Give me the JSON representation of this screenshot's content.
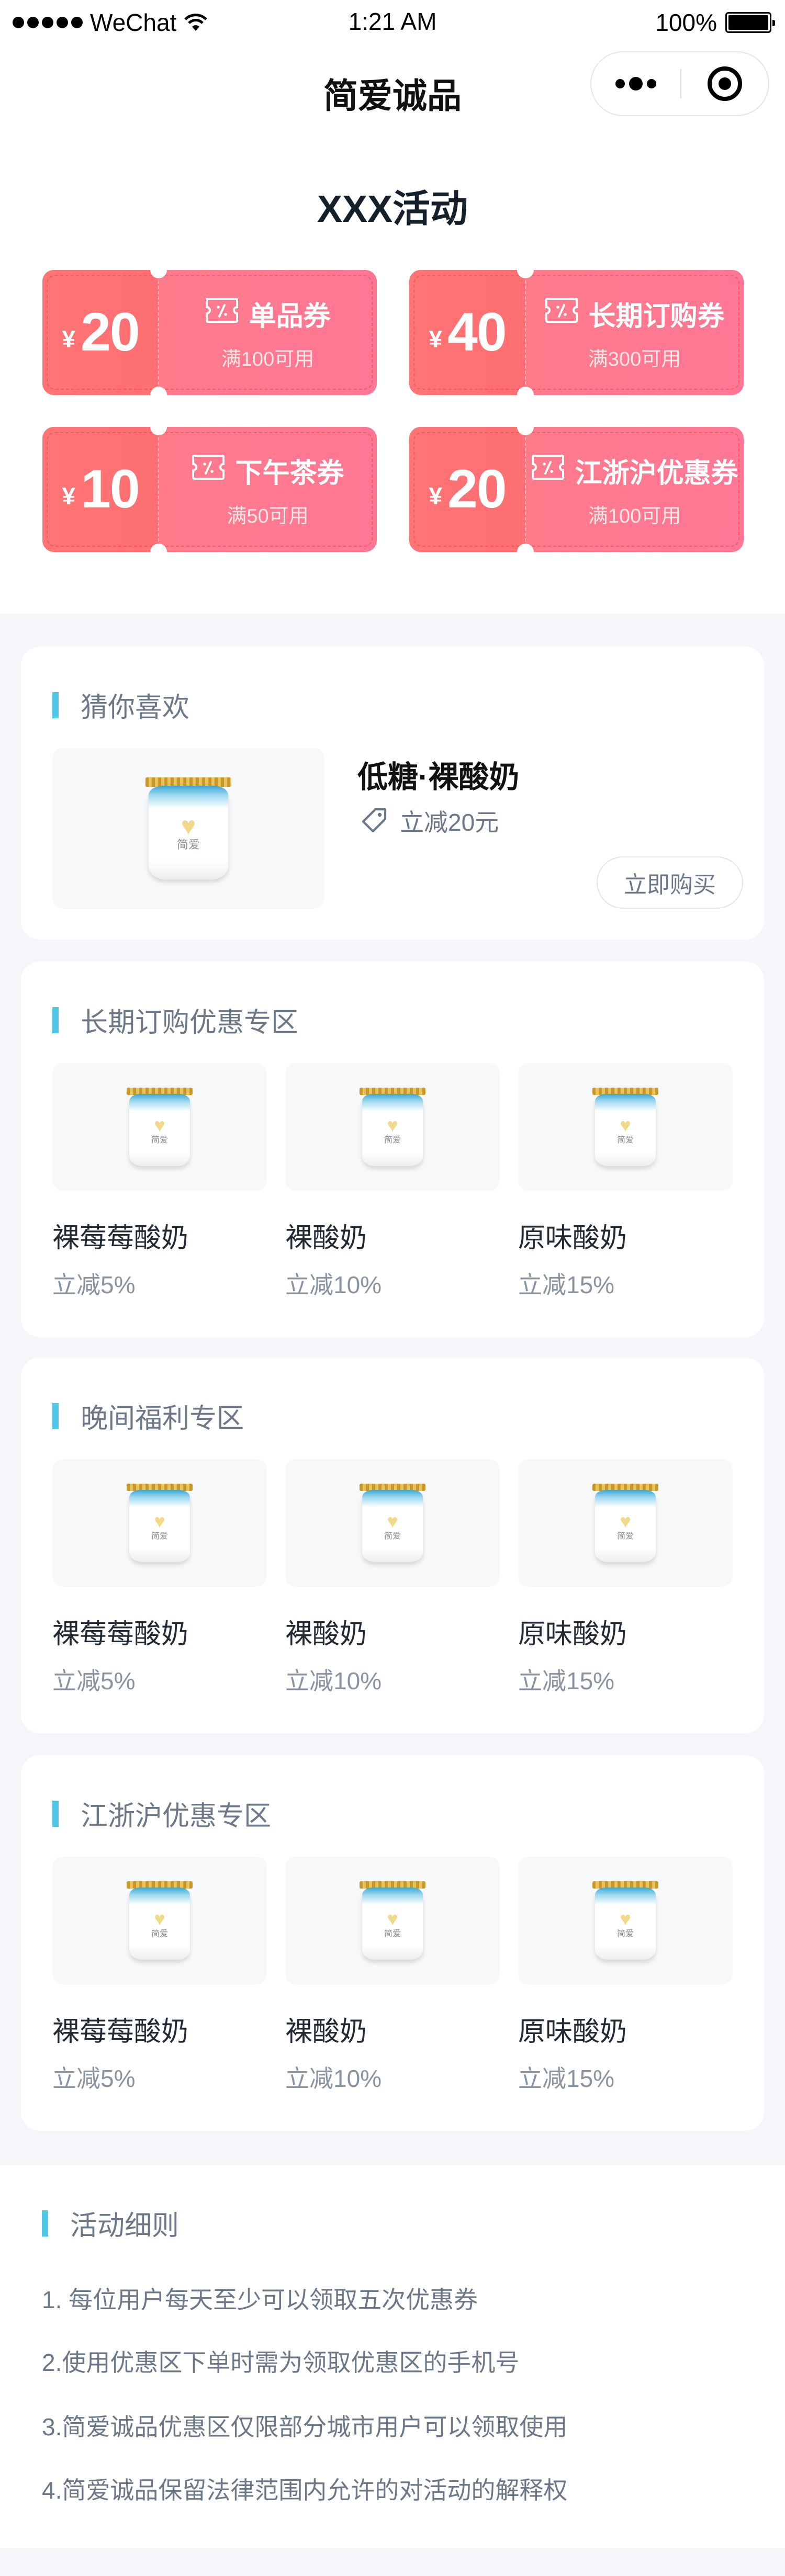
{
  "status_bar": {
    "carrier": "WeChat",
    "time": "1:21 AM",
    "battery": "100%"
  },
  "nav": {
    "title": "简爱诚品"
  },
  "activity_title": "XXX活动",
  "coupons": [
    {
      "currency": "¥",
      "amount": "20",
      "name": "单品券",
      "condition": "满100可用"
    },
    {
      "currency": "¥",
      "amount": "40",
      "name": "长期订购券",
      "condition": "满300可用"
    },
    {
      "currency": "¥",
      "amount": "10",
      "name": "下午茶券",
      "condition": "满50可用"
    },
    {
      "currency": "¥",
      "amount": "20",
      "name": "江浙沪优惠券",
      "condition": "满100可用"
    }
  ],
  "recommend": {
    "title": "猜你喜欢",
    "product": {
      "name": "低糖·裸酸奶",
      "discount": "立减20元",
      "jar_brand": "简爱"
    },
    "buy_label": "立即购买"
  },
  "sections": [
    {
      "title": "长期订购优惠专区",
      "items": [
        {
          "name": "裸莓莓酸奶",
          "discount": "立减5%"
        },
        {
          "name": "裸酸奶",
          "discount": "立减10%"
        },
        {
          "name": "原味酸奶",
          "discount": "立减15%"
        }
      ]
    },
    {
      "title": "晚间福利专区",
      "items": [
        {
          "name": "裸莓莓酸奶",
          "discount": "立减5%"
        },
        {
          "name": "裸酸奶",
          "discount": "立减10%"
        },
        {
          "name": "原味酸奶",
          "discount": "立减15%"
        }
      ]
    },
    {
      "title": "江浙沪优惠专区",
      "items": [
        {
          "name": "裸莓莓酸奶",
          "discount": "立减5%"
        },
        {
          "name": "裸酸奶",
          "discount": "立减10%"
        },
        {
          "name": "原味酸奶",
          "discount": "立减15%"
        }
      ]
    }
  ],
  "rules": {
    "title": "活动细则",
    "items": [
      "1. 每位用户每天至少可以领取五次优惠券",
      "2.使用优惠区下单时需为领取优惠区的手机号",
      "3.简爱诚品优惠区仅限部分城市用户可以领取使用",
      "4.简爱诚品保留法律范围内允许的对活动的解释权"
    ]
  },
  "colors": {
    "coupon": "#ff7d85",
    "accent": "#4fc8e6",
    "background": "#f4f6f9"
  }
}
